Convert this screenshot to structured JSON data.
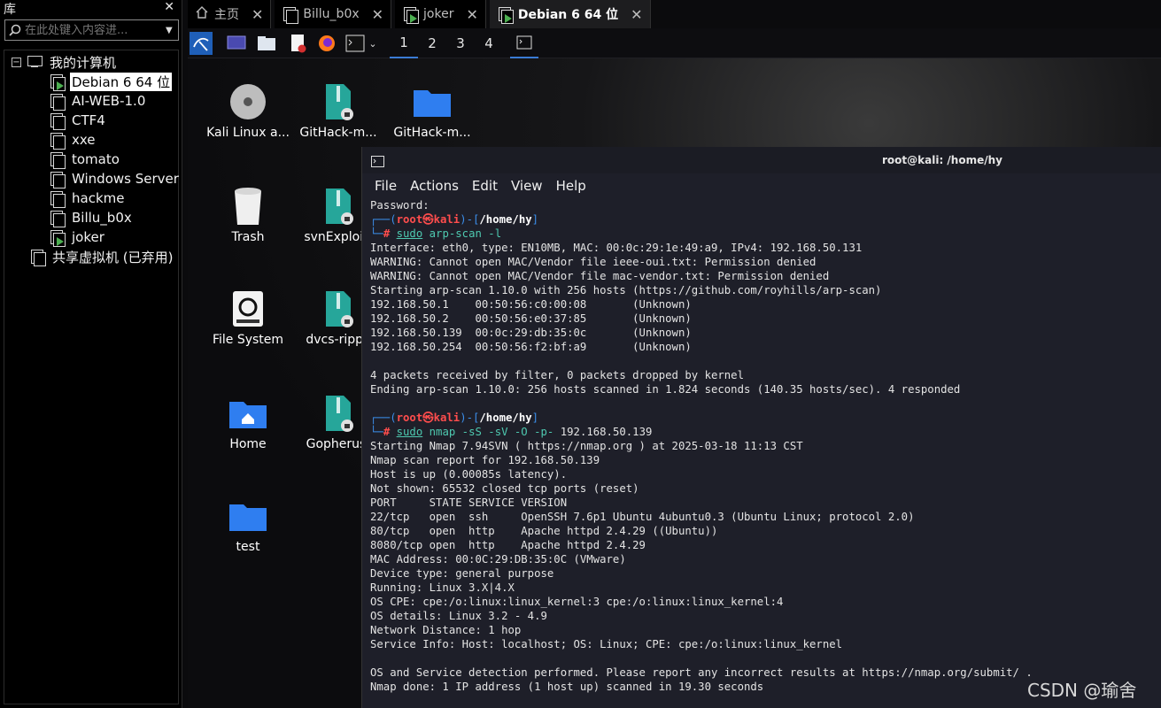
{
  "library": {
    "title": "库",
    "search_placeholder": "在此处键入内容进...",
    "tree": {
      "root": "我的计算机",
      "vms": [
        "Debian 6 64 位",
        "AI-WEB-1.0",
        "CTF4",
        "xxe",
        "tomato",
        "Windows Server",
        "hackme",
        "Billu_b0x",
        "joker"
      ],
      "shared": "共享虚拟机 (已弃用)"
    }
  },
  "tabs": [
    {
      "label": "主页",
      "icon": "home-icon"
    },
    {
      "label": "Billu_b0x",
      "icon": "vm-icon"
    },
    {
      "label": "joker",
      "icon": "vm-running-icon"
    },
    {
      "label": "Debian 6 64 位",
      "icon": "vm-running-icon"
    }
  ],
  "workspaces": [
    "1",
    "2",
    "3",
    "4"
  ],
  "desktop_icons": [
    "Kali Linux a...",
    "GitHack-m...",
    "GitHack-m...",
    "Trash",
    "svnExploit-",
    "File System",
    "dvcs-rippe",
    "Home",
    "Gopherus-",
    "test"
  ],
  "terminal": {
    "title": "root@kali: /home/hy",
    "menu": [
      "File",
      "Actions",
      "Edit",
      "View",
      "Help"
    ],
    "password_line": "Password:",
    "prompt_user": "root",
    "prompt_at": "㉿",
    "prompt_host": "kali",
    "prompt_dir": "/home/hy",
    "cmd1": {
      "sudo": "sudo",
      "rest": "arp-scan -l"
    },
    "arp_output": [
      "Interface: eth0, type: EN10MB, MAC: 00:0c:29:1e:49:a9, IPv4: 192.168.50.131",
      "WARNING: Cannot open MAC/Vendor file ieee-oui.txt: Permission denied",
      "WARNING: Cannot open MAC/Vendor file mac-vendor.txt: Permission denied",
      "Starting arp-scan 1.10.0 with 256 hosts (https://github.com/royhills/arp-scan)",
      "192.168.50.1    00:50:56:c0:00:08       (Unknown)",
      "192.168.50.2    00:50:56:e0:37:85       (Unknown)",
      "192.168.50.139  00:0c:29:db:35:0c       (Unknown)",
      "192.168.50.254  00:50:56:f2:bf:a9       (Unknown)",
      "",
      "4 packets received by filter, 0 packets dropped by kernel",
      "Ending arp-scan 1.10.0: 256 hosts scanned in 1.824 seconds (140.35 hosts/sec). 4 responded"
    ],
    "cmd2": {
      "sudo": "sudo",
      "rest": "nmap -sS -sV -O -p-",
      "target": "192.168.50.139"
    },
    "nmap_output": [
      "Starting Nmap 7.94SVN ( https://nmap.org ) at 2025-03-18 11:13 CST",
      "Nmap scan report for 192.168.50.139",
      "Host is up (0.00085s latency).",
      "Not shown: 65532 closed tcp ports (reset)",
      "PORT     STATE SERVICE VERSION",
      "22/tcp   open  ssh     OpenSSH 7.6p1 Ubuntu 4ubuntu0.3 (Ubuntu Linux; protocol 2.0)",
      "80/tcp   open  http    Apache httpd 2.4.29 ((Ubuntu))",
      "8080/tcp open  http    Apache httpd 2.4.29",
      "MAC Address: 00:0C:29:DB:35:0C (VMware)",
      "Device type: general purpose",
      "Running: Linux 3.X|4.X",
      "OS CPE: cpe:/o:linux:linux_kernel:3 cpe:/o:linux:linux_kernel:4",
      "OS details: Linux 3.2 - 4.9",
      "Network Distance: 1 hop",
      "Service Info: Host: localhost; OS: Linux; CPE: cpe:/o:linux:linux_kernel",
      "",
      "OS and Service detection performed. Please report any incorrect results at https://nmap.org/submit/ .",
      "Nmap done: 1 IP address (1 host up) scanned in 19.30 seconds"
    ]
  },
  "watermark": "CSDN @瑜舍",
  "colors": {
    "accent": "#3a7bd5",
    "prompt_red": "#ff4d4d",
    "prompt_blue": "#3b8eea",
    "cmd_green": "#4ec9b0",
    "vm_running": "#4caf50"
  }
}
